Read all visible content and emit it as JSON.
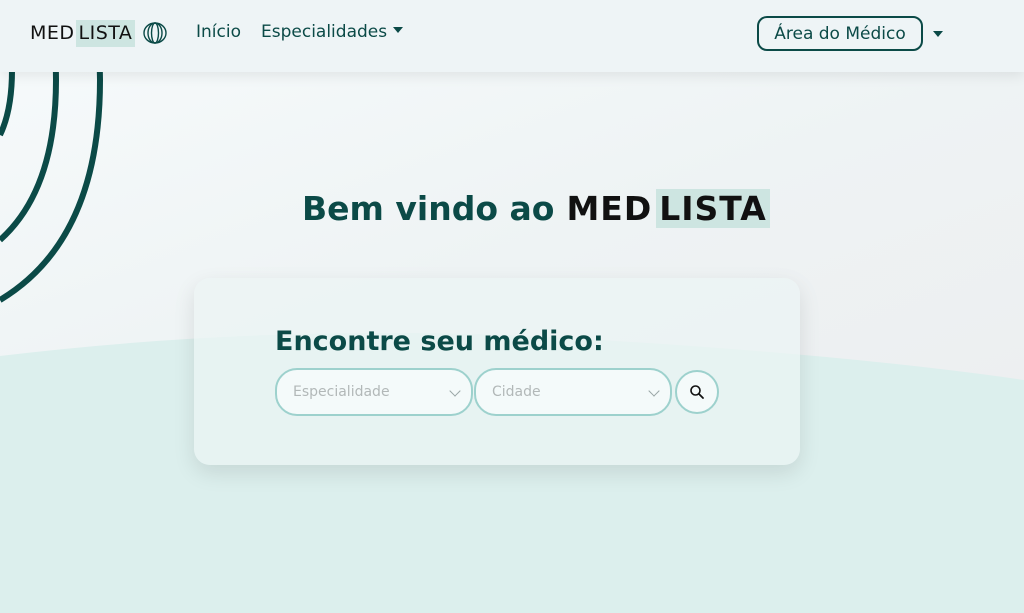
{
  "brand": {
    "part1": "MED",
    "part2": "LISTA",
    "icon": "rings-icon"
  },
  "nav": {
    "inicio": "Início",
    "especialidades": "Especialidades",
    "medico": "Área do Médico"
  },
  "hero": {
    "welcome": "Bem vindo ao",
    "brand1": "MED",
    "brand2": "LISTA"
  },
  "search": {
    "title": "Encontre seu médico:",
    "especialidade_placeholder": "Especialidade",
    "cidade_placeholder": "Cidade",
    "search_icon": "search-icon"
  },
  "colors": {
    "primary": "#0b4a47",
    "accent_light": "#cde5e1",
    "wave": "#dcefed",
    "border": "#9dd1cd"
  }
}
